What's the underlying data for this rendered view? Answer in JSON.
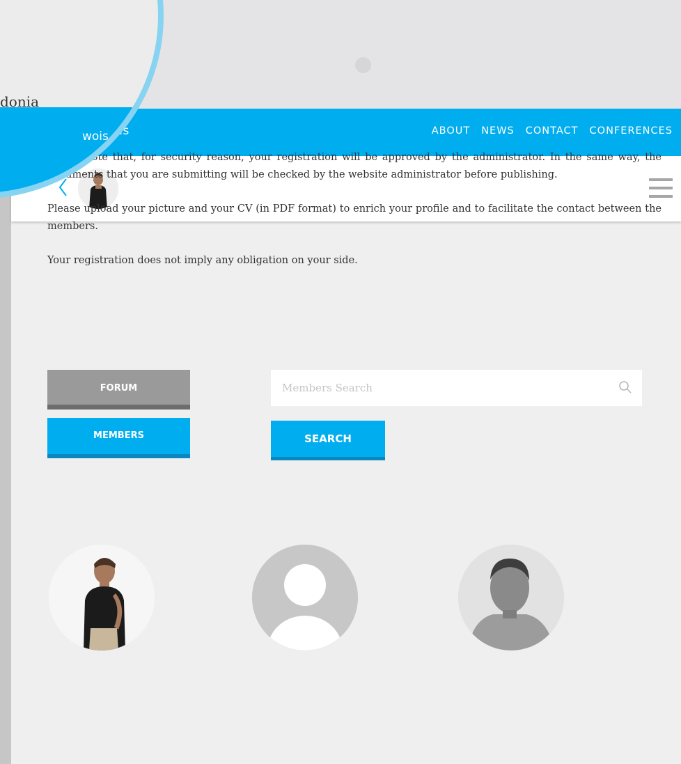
{
  "site": {
    "name": "wois",
    "zoom_text": "donia"
  },
  "nav": {
    "links": [
      "ABOUT",
      "NEWS",
      "CONTACT",
      "CONFERENCES"
    ]
  },
  "subbar": {
    "back_icon": "chevron-left-icon",
    "menu_icon": "hamburger-menu-icon"
  },
  "intro": {
    "paragraphs": [
      "Please note that, for security reason, your registration will be approved by the administrator. In the same way, the documents that you are submitting will be checked by the website administrator before publishing.",
      "Please upload your picture and your CV (in PDF format) to enrich your profile and to facilitate the contact between the members.",
      "Your registration does not imply any obligation on your side."
    ]
  },
  "buttons": {
    "forum": "FORUM",
    "members": "MEMBERS",
    "search": "SEARCH"
  },
  "search": {
    "placeholder": "Members Search",
    "value": ""
  },
  "colors": {
    "accent": "#00adef",
    "accent_dark": "#0a86c0",
    "forum_gray": "#9a9a9a",
    "lens_border": "#86d3f2"
  },
  "members": [
    {
      "avatar": "member-photo-young-man"
    },
    {
      "avatar": "default-user-placeholder"
    },
    {
      "avatar": "member-photo-older-man"
    }
  ]
}
